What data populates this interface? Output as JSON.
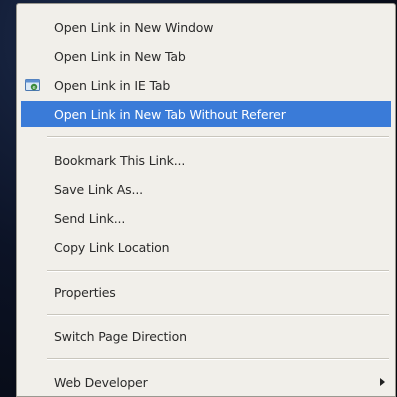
{
  "menu": {
    "items": [
      {
        "label": "Open Link in New Window"
      },
      {
        "label": "Open Link in New Tab"
      },
      {
        "label": "Open Link in IE Tab",
        "icon": "ie-tab-icon"
      },
      {
        "label": "Open Link in New Tab Without Referer",
        "highlighted": true
      },
      {
        "label": "Bookmark This Link..."
      },
      {
        "label": "Save Link As..."
      },
      {
        "label": "Send Link..."
      },
      {
        "label": "Copy Link Location"
      },
      {
        "label": "Properties"
      },
      {
        "label": "Switch Page Direction"
      },
      {
        "label": "Web Developer",
        "submenu": true,
        "icon": "submenu-arrow-icon"
      }
    ]
  },
  "colors": {
    "highlight": "#3a7bd8",
    "menu_bg": "#f1efea",
    "backdrop": "#0a0f1c"
  }
}
